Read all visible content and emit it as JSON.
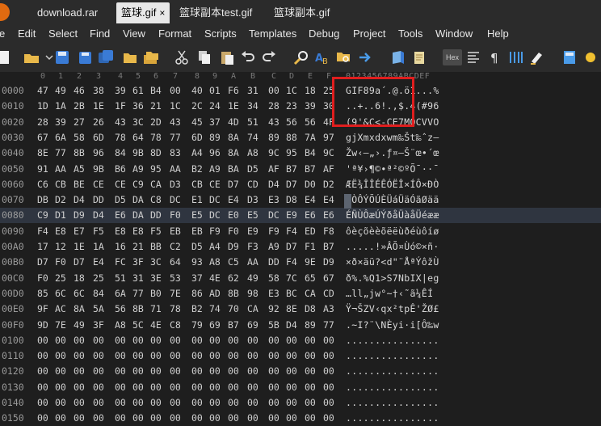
{
  "tabs": [
    {
      "label": "download.rar",
      "active": false
    },
    {
      "label": "篮球.gif",
      "active": true,
      "close": "×"
    },
    {
      "label": "篮球副本test.gif",
      "active": false
    },
    {
      "label": "篮球副本.gif",
      "active": false
    }
  ],
  "menu": [
    "e",
    "Edit",
    "Select",
    "Find",
    "View",
    "Format",
    "Scripts",
    "Templates",
    "Debug",
    "Project",
    "Tools",
    "Window",
    "Help"
  ],
  "toolbar": {
    "hex_label": "Hex",
    "icons": [
      "new-file-icon",
      "open-folder-icon",
      "save-icon",
      "save-as-icon",
      "save-all-icon",
      "open-folder-small-icon",
      "copy-folder-icon",
      "cut-icon",
      "copy-icon",
      "paste-icon",
      "undo-icon",
      "redo-icon",
      "find-icon",
      "replace-icon",
      "find-in-files-icon",
      "goto-icon",
      "run-script-icon",
      "script-history-icon",
      "hex-mode-icon",
      "columns-icon",
      "paragraph-icon",
      "column-view-icon",
      "highlight-icon",
      "calculator-icon",
      "settings-icon"
    ]
  },
  "editor": {
    "ruler_bytes": [
      "0",
      "1",
      "2",
      "3",
      "4",
      "5",
      "6",
      "7",
      "8",
      "9",
      "A",
      "B",
      "C",
      "D",
      "E",
      "F"
    ],
    "ruler_ascii": "0123456789ABCDEF",
    "rows": [
      {
        "addr": "0000",
        "bytes": [
          "47",
          "49",
          "46",
          "38",
          "39",
          "61",
          "B4",
          "00",
          "40",
          "01",
          "F6",
          "31",
          "00",
          "1C",
          "18",
          "25"
        ],
        "ascii": "GIF89a´.@.ö1...%"
      },
      {
        "addr": "0010",
        "bytes": [
          "1D",
          "1A",
          "2B",
          "1E",
          "1F",
          "36",
          "21",
          "1C",
          "2C",
          "24",
          "1E",
          "34",
          "28",
          "23",
          "39",
          "30"
        ],
        "ascii": "..+..6!.,$.4(#96"
      },
      {
        "addr": "0020",
        "bytes": [
          "28",
          "39",
          "27",
          "26",
          "43",
          "3C",
          "2D",
          "43",
          "45",
          "37",
          "4D",
          "51",
          "43",
          "56",
          "56",
          "4F"
        ],
        "ascii": "(9'&C<-CE7MQCVVO"
      },
      {
        "addr": "0030",
        "bytes": [
          "67",
          "6A",
          "58",
          "6D",
          "78",
          "64",
          "78",
          "77",
          "6D",
          "89",
          "8A",
          "74",
          "89",
          "88",
          "7A",
          "97"
        ],
        "ascii": "gjXmxdxwm‰Št‰ˆz—"
      },
      {
        "addr": "0040",
        "bytes": [
          "8E",
          "77",
          "8B",
          "96",
          "84",
          "9B",
          "8D",
          "83",
          "A4",
          "96",
          "8A",
          "A8",
          "9C",
          "95",
          "B4",
          "9C"
        ],
        "ascii": "Žw‹–„›.ƒ¤–Š¨œ•´œ"
      },
      {
        "addr": "0050",
        "bytes": [
          "91",
          "AA",
          "A5",
          "9B",
          "B6",
          "A9",
          "95",
          "AA",
          "B2",
          "A9",
          "BA",
          "D5",
          "AF",
          "B7",
          "B7",
          "AF"
        ],
        "ascii": "'ª¥›¶©•ª²©ºÕ¯··¯"
      },
      {
        "addr": "0060",
        "bytes": [
          "C6",
          "CB",
          "BE",
          "CE",
          "CE",
          "C9",
          "CA",
          "D3",
          "CB",
          "CE",
          "D7",
          "CD",
          "D4",
          "D7",
          "D0",
          "D2"
        ],
        "ascii": "ÆË¾ÎÎÉÊÓËÎ×ÍÔ×ÐÒ"
      },
      {
        "addr": "0070",
        "bytes": [
          "DB",
          "D2",
          "D4",
          "DD",
          "D5",
          "DA",
          "C8",
          "DC",
          "E1",
          "DC",
          "E4",
          "D3",
          "E3",
          "D8",
          "E4",
          "E4"
        ],
        "ascii": "ÛÒÔÝÕÚÈÜáÜäÓãØää"
      },
      {
        "addr": "0080",
        "bytes": [
          "C9",
          "D1",
          "D9",
          "D4",
          "E6",
          "DA",
          "DD",
          "F0",
          "E5",
          "DC",
          "E0",
          "E5",
          "DC",
          "E9",
          "E6",
          "E6"
        ],
        "ascii": "ÉÑÙÔæÚÝðåÜàåÜéææ",
        "highlight": true
      },
      {
        "addr": "0090",
        "bytes": [
          "F4",
          "E8",
          "E7",
          "F5",
          "E8",
          "E8",
          "F5",
          "EB",
          "EB",
          "F9",
          "F0",
          "E9",
          "F9",
          "F4",
          "ED",
          "F8"
        ],
        "ascii": "ôèçõèèõëëùðéùôíø"
      },
      {
        "addr": "00A0",
        "bytes": [
          "17",
          "12",
          "1E",
          "1A",
          "16",
          "21",
          "BB",
          "C2",
          "D5",
          "A4",
          "D9",
          "F3",
          "A9",
          "D7",
          "F1",
          "B7"
        ],
        "ascii": ".....!»ÂÕ¤Ùó©×ñ·"
      },
      {
        "addr": "00B0",
        "bytes": [
          "D7",
          "F0",
          "D7",
          "E4",
          "FC",
          "3F",
          "3C",
          "64",
          "93",
          "A8",
          "C5",
          "AA",
          "DD",
          "F4",
          "9E",
          "D9"
        ],
        "ascii": "×ð×äü?<d\"¨ÅªÝôžÙ"
      },
      {
        "addr": "00C0",
        "bytes": [
          "F0",
          "25",
          "18",
          "25",
          "51",
          "31",
          "3E",
          "53",
          "37",
          "4E",
          "62",
          "49",
          "58",
          "7C",
          "65",
          "67"
        ],
        "ascii": "ð%.%Q1>S7NbIX|eg"
      },
      {
        "addr": "00D0",
        "bytes": [
          "85",
          "6C",
          "6C",
          "84",
          "6A",
          "77",
          "B0",
          "7E",
          "86",
          "AD",
          "8B",
          "98",
          "E3",
          "BC",
          "CA",
          "CD"
        ],
        "ascii": "…ll„jw°~†­‹˜ã¼ÊÍ"
      },
      {
        "addr": "00E0",
        "bytes": [
          "9F",
          "AC",
          "8A",
          "5A",
          "56",
          "8B",
          "71",
          "78",
          "B2",
          "74",
          "70",
          "CA",
          "92",
          "8E",
          "D8",
          "A3"
        ],
        "ascii": "Ÿ¬ŠZV‹qx²tpÊ'ŽØ£"
      },
      {
        "addr": "00F0",
        "bytes": [
          "9D",
          "7E",
          "49",
          "3F",
          "A8",
          "5C",
          "4E",
          "C8",
          "79",
          "69",
          "B7",
          "69",
          "5B",
          "D4",
          "89",
          "77"
        ],
        "ascii": ".~I?¨\\NÈyi·i[Ô‰w"
      },
      {
        "addr": "0100",
        "bytes": [
          "00",
          "00",
          "00",
          "00",
          "00",
          "00",
          "00",
          "00",
          "00",
          "00",
          "00",
          "00",
          "00",
          "00",
          "00",
          "00"
        ],
        "ascii": "................"
      },
      {
        "addr": "0110",
        "bytes": [
          "00",
          "00",
          "00",
          "00",
          "00",
          "00",
          "00",
          "00",
          "00",
          "00",
          "00",
          "00",
          "00",
          "00",
          "00",
          "00"
        ],
        "ascii": "................"
      },
      {
        "addr": "0120",
        "bytes": [
          "00",
          "00",
          "00",
          "00",
          "00",
          "00",
          "00",
          "00",
          "00",
          "00",
          "00",
          "00",
          "00",
          "00",
          "00",
          "00"
        ],
        "ascii": "................"
      },
      {
        "addr": "0130",
        "bytes": [
          "00",
          "00",
          "00",
          "00",
          "00",
          "00",
          "00",
          "00",
          "00",
          "00",
          "00",
          "00",
          "00",
          "00",
          "00",
          "00"
        ],
        "ascii": "................"
      },
      {
        "addr": "0140",
        "bytes": [
          "00",
          "00",
          "00",
          "00",
          "00",
          "00",
          "00",
          "00",
          "00",
          "00",
          "00",
          "00",
          "00",
          "00",
          "00",
          "00"
        ],
        "ascii": "................"
      },
      {
        "addr": "0150",
        "bytes": [
          "00",
          "00",
          "00",
          "00",
          "00",
          "00",
          "00",
          "00",
          "00",
          "00",
          "00",
          "00",
          "00",
          "00",
          "00",
          "00"
        ],
        "ascii": "................"
      }
    ]
  }
}
